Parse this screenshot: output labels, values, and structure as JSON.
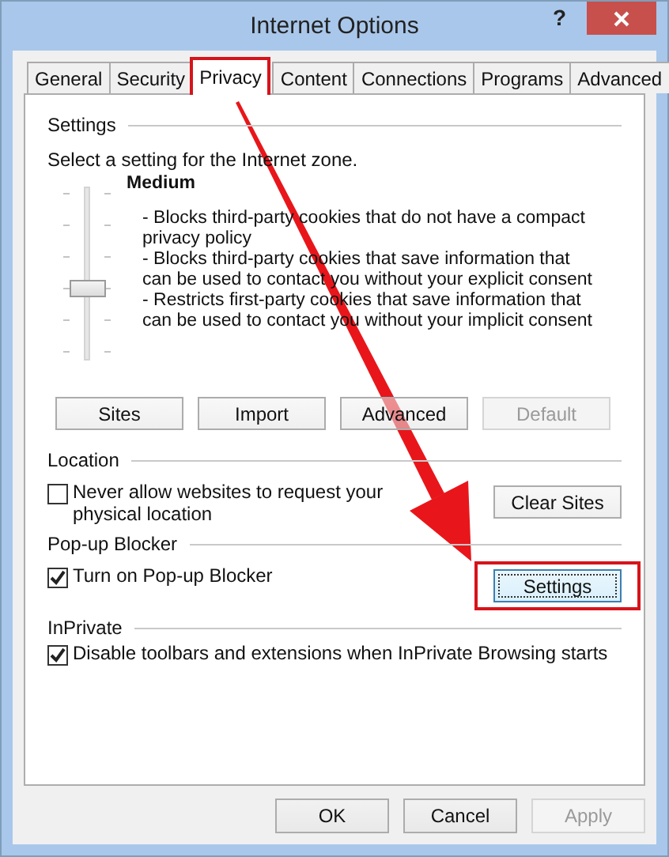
{
  "window": {
    "title": "Internet Options",
    "help": "?"
  },
  "tabs": [
    {
      "label": "General",
      "selected": false,
      "highlighted": false
    },
    {
      "label": "Security",
      "selected": false,
      "highlighted": false
    },
    {
      "label": "Privacy",
      "selected": true,
      "highlighted": true
    },
    {
      "label": "Content",
      "selected": false,
      "highlighted": false
    },
    {
      "label": "Connections",
      "selected": false,
      "highlighted": false
    },
    {
      "label": "Programs",
      "selected": false,
      "highlighted": false
    },
    {
      "label": "Advanced",
      "selected": false,
      "highlighted": false
    }
  ],
  "settings": {
    "heading": "Settings",
    "intro": "Select a setting for the Internet zone.",
    "level_name": "Medium",
    "slider": {
      "level": 0.4
    },
    "description": [
      "- Blocks third-party cookies that do not have a compact privacy policy",
      "- Blocks third-party cookies that save information that can be used to contact you without your explicit consent",
      "- Restricts first-party cookies that save information that can be used to contact you without your implicit consent"
    ],
    "buttons": [
      {
        "label": "Sites",
        "disabled": false
      },
      {
        "label": "Import",
        "disabled": false
      },
      {
        "label": "Advanced",
        "disabled": false
      },
      {
        "label": "Default",
        "disabled": true
      }
    ]
  },
  "location": {
    "heading": "Location",
    "checkbox": {
      "label": "Never allow websites to request your physical location",
      "checked": false
    },
    "button": {
      "label": "Clear Sites",
      "highlighted": false
    }
  },
  "popup_blocker": {
    "heading": "Pop-up Blocker",
    "checkbox": {
      "label": "Turn on Pop-up Blocker",
      "checked": true
    },
    "button": {
      "label": "Settings",
      "highlighted": true
    }
  },
  "inprivate": {
    "heading": "InPrivate",
    "checkbox": {
      "label": "Disable toolbars and extensions when InPrivate Browsing starts",
      "checked": true
    }
  },
  "footer_buttons": [
    {
      "label": "OK",
      "disabled": false
    },
    {
      "label": "Cancel",
      "disabled": false
    },
    {
      "label": "Apply",
      "disabled": true
    }
  ],
  "arrow": {
    "shown": true
  }
}
